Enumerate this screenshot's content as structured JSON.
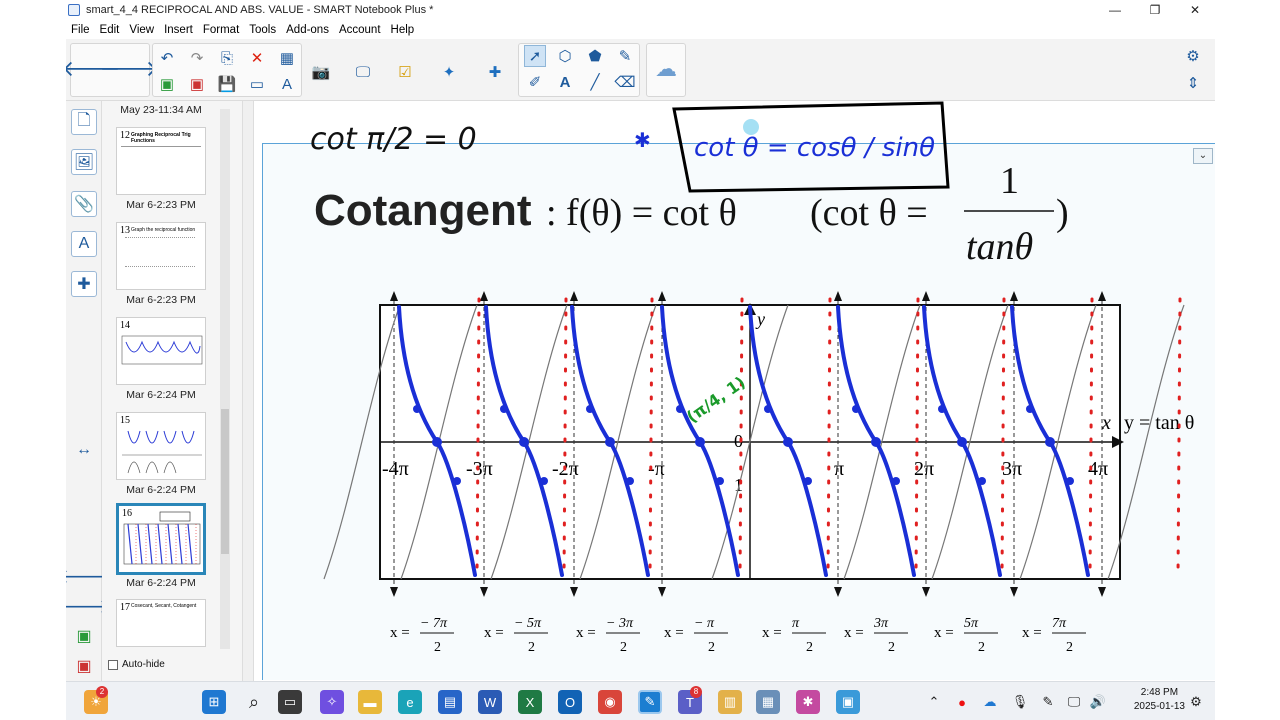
{
  "window": {
    "title": "smart_4_4 RECIPROCAL AND ABS. VALUE - SMART Notebook Plus *",
    "minimize": "—",
    "maximize": "❐",
    "close": "✕"
  },
  "menu": [
    "File",
    "Edit",
    "View",
    "Insert",
    "Format",
    "Tools",
    "Add-ons",
    "Account",
    "Help"
  ],
  "toolbar": {
    "icons": [
      "back-icon",
      "forward-icon",
      "undo-icon",
      "redo-icon",
      "add-page-icon",
      "delete-icon",
      "table-icon",
      "screen-shade-icon",
      "capture-icon",
      "display-icon",
      "lesson-activity-icon",
      "addons-icon",
      "select-icon",
      "shapes-icon",
      "eraser-icon",
      "text-icon",
      "line-icon",
      "pen-icon",
      "fill-icon",
      "settings-icon",
      "move-toolbar-icon"
    ]
  },
  "sorter": {
    "header_time": "May 23-11:34 AM",
    "pages": [
      {
        "num": "12",
        "label": "Mar 6-2:23 PM",
        "snippet": "Graphing Reciprocal Trig Functions"
      },
      {
        "num": "13",
        "label": "Mar 6-2:23 PM",
        "snippet": "Graph the reciprocal function"
      },
      {
        "num": "14",
        "label": "Mar 6-2:24 PM",
        "snippet": ""
      },
      {
        "num": "15",
        "label": "Mar 6-2:24 PM",
        "snippet": ""
      },
      {
        "num": "16",
        "label": "Mar 6-2:24 PM",
        "snippet": ""
      },
      {
        "num": "17",
        "label": "",
        "snippet": "Cosecant, Secant, Cotangent"
      }
    ],
    "autohide": "Auto-hide"
  },
  "slide": {
    "handwritten_top": "cot π/2 = 0",
    "handwritten_box": "cot θ = cosθ / sinθ",
    "title_bold": "Cotangent",
    "formula_main": ": f(θ) = cot θ",
    "formula_paren_open": "(cot θ =",
    "formula_num": "1",
    "formula_den": "tanθ",
    "formula_paren_close": ")",
    "graph": {
      "y_axis_label": "y",
      "x_axis_label": "x",
      "right_label": "y = tan θ",
      "origin": "0",
      "tick_labels": [
        "-4π",
        "-3π",
        "-2π",
        "-π",
        "π",
        "2π",
        "3π",
        "4π"
      ],
      "one_label": "1",
      "point_label": "(π/4, 1)",
      "asymptotes": [
        {
          "x": "x =",
          "num": "− 7π",
          "den": "2"
        },
        {
          "x": "x =",
          "num": "− 5π",
          "den": "2"
        },
        {
          "x": "x =",
          "num": "− 3π",
          "den": "2"
        },
        {
          "x": "x =",
          "num": "− π",
          "den": "2"
        },
        {
          "x": "x =",
          "num": "π",
          "den": "2"
        },
        {
          "x": "x =",
          "num": "3π",
          "den": "2"
        },
        {
          "x": "x =",
          "num": "5π",
          "den": "2"
        },
        {
          "x": "x =",
          "num": "7π",
          "den": "2"
        }
      ]
    }
  },
  "taskbar": {
    "time": "2:48 PM",
    "date": "2025-01-13",
    "weather_badge": "2",
    "teams_badge": "8",
    "apps": [
      "weather-icon",
      "start-icon",
      "search-icon",
      "task-view-icon",
      "copilot-icon",
      "file-explorer-icon",
      "edge-icon",
      "store-icon",
      "word-icon",
      "excel-icon",
      "outlook-icon",
      "chrome-icon",
      "smart-notebook-icon",
      "teams-icon",
      "apps-icon",
      "app-icon-2",
      "app-icon-3",
      "app-icon-4"
    ]
  },
  "colors": {
    "accent": "#2a86b8",
    "ink_blue": "#1a2fd6",
    "ink_red": "#e02020",
    "ink_green": "#1a9a2a"
  }
}
